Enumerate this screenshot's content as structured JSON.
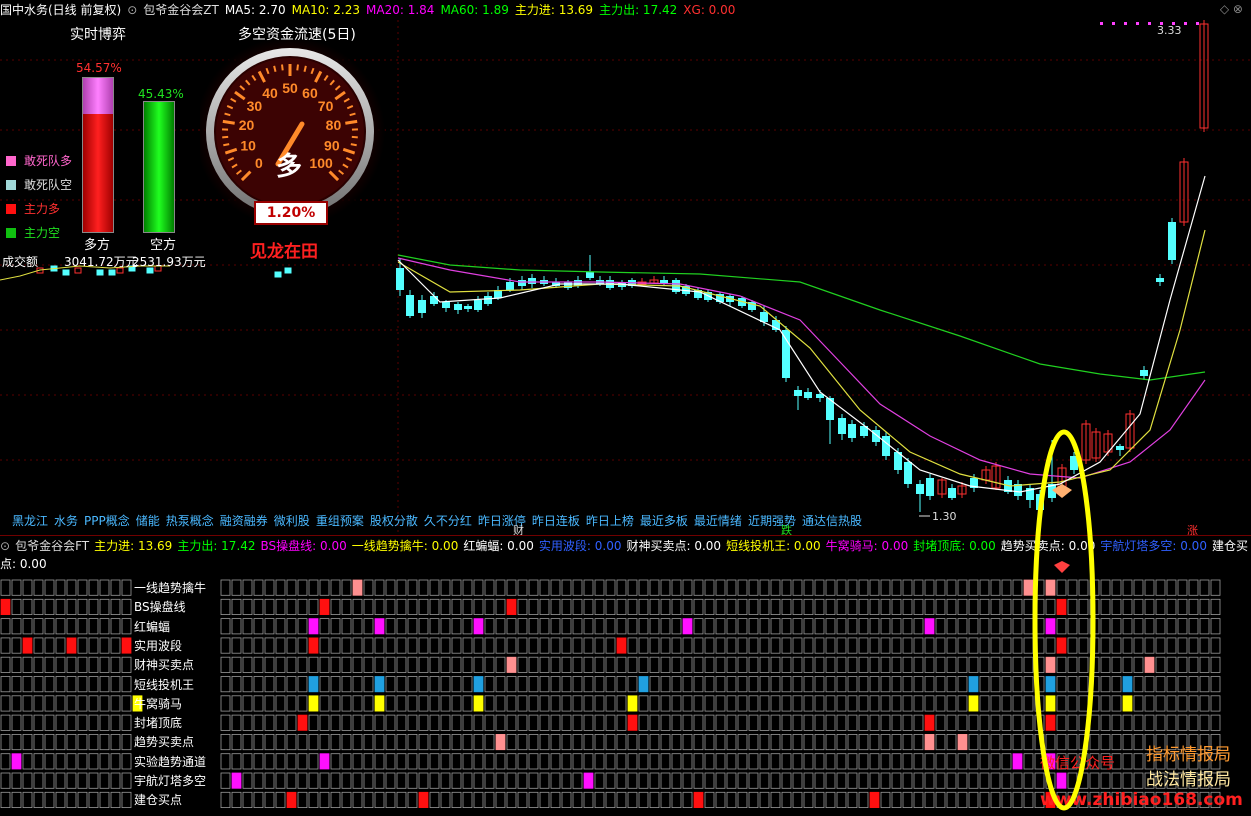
{
  "top_bar": {
    "stock": "国中水务(日线 前复权)",
    "indicator_name": "包爷金谷会ZT",
    "fields": [
      {
        "label": "MA5: 2.70",
        "color": "#ffffff"
      },
      {
        "label": "MA10: 2.23",
        "color": "#ffff00"
      },
      {
        "label": "MA20: 1.84",
        "color": "#ff00ff"
      },
      {
        "label": "MA60: 1.89",
        "color": "#00ff00"
      },
      {
        "label": "主力进: 13.69",
        "color": "#ffff00"
      },
      {
        "label": "主力出: 17.42",
        "color": "#00ff00"
      },
      {
        "label": "XG: 0.00",
        "color": "#ff3030"
      }
    ],
    "price_high": "3.33",
    "price_low": "1.30"
  },
  "panel": {
    "title": "实时博弈",
    "flow_title": "多空资金流速(5日)",
    "bull_pct": "54.57%",
    "bear_pct": "45.43%",
    "bull_fill": 0.5457,
    "bear_fill": 0.4543,
    "bull_label": "多方",
    "bear_label": "空方",
    "bull_amount": "3041.72万元",
    "bear_amount": "2531.93万元",
    "volume_label": "成交额",
    "legend": [
      {
        "label": "敢死队多",
        "color": "#ff66cc"
      },
      {
        "label": "敢死队空",
        "color": "#a0d8d8"
      },
      {
        "label": "主力多",
        "color": "#ff1010"
      },
      {
        "label": "主力空",
        "color": "#10c010"
      }
    ],
    "gauge_ticks": [
      "0",
      "10",
      "20",
      "30",
      "40",
      "50",
      "60",
      "70",
      "80",
      "90",
      "100"
    ],
    "gauge_center": "多",
    "gauge_value": "1.20%",
    "slogan": "见龙在田"
  },
  "tags": [
    "黑龙江",
    "水务",
    "PPP概念",
    "储能",
    "热泵概念",
    "融资融券",
    "微利股",
    "重组预案",
    "股权分散",
    "久不分红",
    "昨日涨停",
    "昨日连板",
    "昨日上榜",
    "最近多板",
    "最近情绪",
    "近期强势",
    "通达信热股"
  ],
  "markers": {
    "cai": "财",
    "die": "跌",
    "zhang": "涨"
  },
  "mid_bar": {
    "indicator_name": "包爷金谷会FT",
    "fields": [
      {
        "label": "主力进: 13.69",
        "color": "#ffff00"
      },
      {
        "label": "主力出: 17.42",
        "color": "#00ff00"
      },
      {
        "label": "BS操盘线: 0.00",
        "color": "#ff00ff"
      },
      {
        "label": "一线趋势擒牛: 0.00",
        "color": "#ffff00"
      },
      {
        "label": "红蝙蝠: 0.00",
        "color": "#ffffff"
      },
      {
        "label": "实用波段: 0.00",
        "color": "#3060ff"
      },
      {
        "label": "财神买卖点: 0.00",
        "color": "#ffffff"
      },
      {
        "label": "短线投机王: 0.00",
        "color": "#ffff00"
      },
      {
        "label": "牛窝骑马: 0.00",
        "color": "#ff00ff"
      },
      {
        "label": "封堵顶底: 0.00",
        "color": "#00ff00"
      },
      {
        "label": "趋势买卖点: 0.00",
        "color": "#ffffff"
      },
      {
        "label": "宇航灯塔多空: 0.00",
        "color": "#3060ff"
      },
      {
        "label": "建仓买点: 0.00",
        "color": "#ffffff"
      }
    ]
  },
  "grid_rows": [
    "一线趋势擒牛",
    "BS操盘线",
    "红蝙蝠",
    "实用波段",
    "财神买卖点",
    "短线投机王",
    "牛窝骑马",
    "封堵顶底",
    "趋势买卖点",
    "实验趋势通道",
    "宇航灯塔多空",
    "建仓买点"
  ],
  "watermark": {
    "wechat": "微信公众号",
    "brand1": "指标情报局",
    "brand2": "战法情报局",
    "url": "www.zhibiao168.com"
  }
}
